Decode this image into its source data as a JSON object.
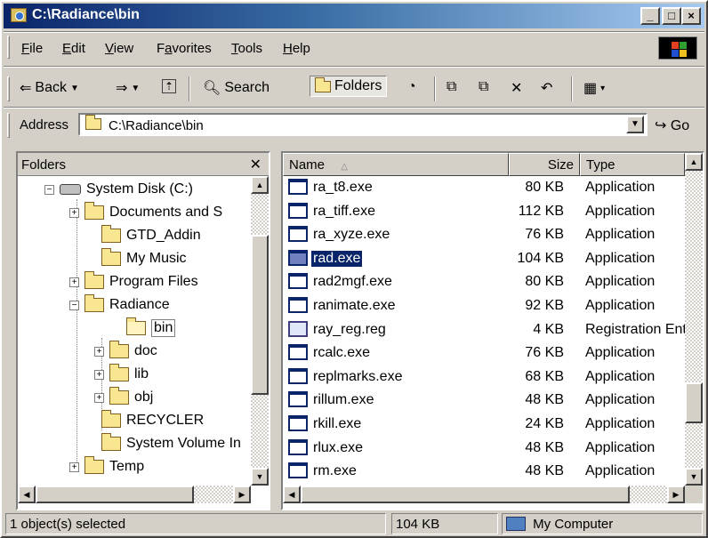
{
  "window": {
    "title": "C:\\Radiance\\bin"
  },
  "menu": [
    "File",
    "Edit",
    "View",
    "Favorites",
    "Tools",
    "Help"
  ],
  "menu_underline": [
    "F",
    "E",
    "V",
    "a",
    "T",
    "H"
  ],
  "toolbar": {
    "back": "Back",
    "search": "Search",
    "folders": "Folders"
  },
  "address": {
    "label": "Address",
    "value": "C:\\Radiance\\bin",
    "go": "Go"
  },
  "folders_pane": {
    "title": "Folders",
    "tree": [
      {
        "label": "System Disk (C:)",
        "level": 0,
        "expander": "−",
        "kind": "disk"
      },
      {
        "label": "Documents and S",
        "level": 1,
        "expander": "+",
        "kind": "folder"
      },
      {
        "label": "GTD_Addin",
        "level": 1,
        "expander": "",
        "kind": "folder"
      },
      {
        "label": "My Music",
        "level": 1,
        "expander": "",
        "kind": "folder"
      },
      {
        "label": "Program Files",
        "level": 1,
        "expander": "+",
        "kind": "folder"
      },
      {
        "label": "Radiance",
        "level": 1,
        "expander": "−",
        "kind": "folder"
      },
      {
        "label": "bin",
        "level": 2,
        "expander": "",
        "kind": "folder-open",
        "selected": true
      },
      {
        "label": "doc",
        "level": 2,
        "expander": "+",
        "kind": "folder"
      },
      {
        "label": "lib",
        "level": 2,
        "expander": "+",
        "kind": "folder"
      },
      {
        "label": "obj",
        "level": 2,
        "expander": "+",
        "kind": "folder"
      },
      {
        "label": "RECYCLER",
        "level": 1,
        "expander": "",
        "kind": "folder"
      },
      {
        "label": "System Volume In",
        "level": 1,
        "expander": "",
        "kind": "folder"
      },
      {
        "label": "Temp",
        "level": 1,
        "expander": "+",
        "kind": "folder"
      }
    ]
  },
  "file_list": {
    "columns": {
      "name": "Name",
      "size": "Size",
      "type": "Type"
    },
    "rows": [
      {
        "name": "ra_t8.exe",
        "size": "80 KB",
        "type": "Application"
      },
      {
        "name": "ra_tiff.exe",
        "size": "112 KB",
        "type": "Application"
      },
      {
        "name": "ra_xyze.exe",
        "size": "76 KB",
        "type": "Application"
      },
      {
        "name": "rad.exe",
        "size": "104 KB",
        "type": "Application",
        "selected": true
      },
      {
        "name": "rad2mgf.exe",
        "size": "80 KB",
        "type": "Application"
      },
      {
        "name": "ranimate.exe",
        "size": "92 KB",
        "type": "Application"
      },
      {
        "name": "ray_reg.reg",
        "size": "4 KB",
        "type": "Registration Ent",
        "icon": "reg"
      },
      {
        "name": "rcalc.exe",
        "size": "76 KB",
        "type": "Application"
      },
      {
        "name": "replmarks.exe",
        "size": "68 KB",
        "type": "Application"
      },
      {
        "name": "rillum.exe",
        "size": "48 KB",
        "type": "Application"
      },
      {
        "name": "rkill.exe",
        "size": "24 KB",
        "type": "Application"
      },
      {
        "name": "rlux.exe",
        "size": "48 KB",
        "type": "Application"
      },
      {
        "name": "rm.exe",
        "size": "48 KB",
        "type": "Application"
      }
    ]
  },
  "status": {
    "selection": "1 object(s) selected",
    "size": "104 KB",
    "zone": "My Computer"
  },
  "colors": {
    "title_start": "#0a246a",
    "title_end": "#a6caf0",
    "selection": "#0a246a",
    "face": "#d4d0c8"
  }
}
